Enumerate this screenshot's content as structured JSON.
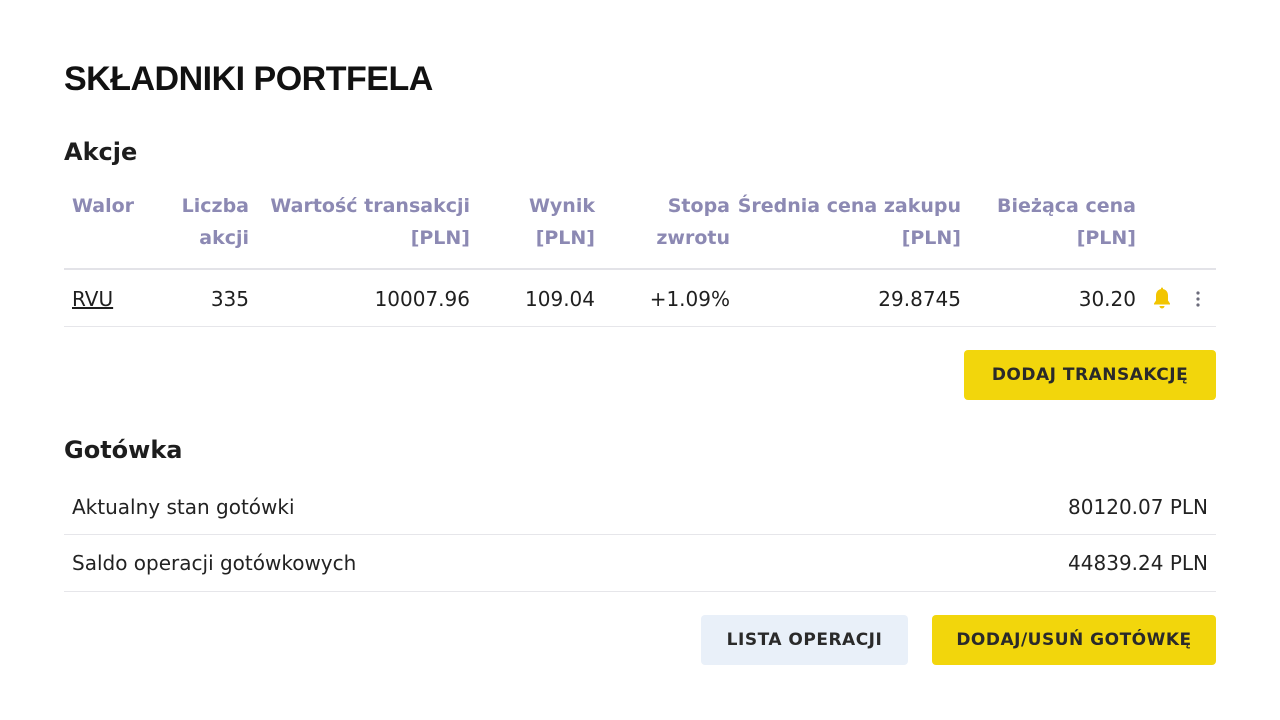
{
  "page": {
    "title": "SKŁADNIKI PORTFELA"
  },
  "stocks": {
    "title": "Akcje",
    "headers": {
      "walor": "Walor",
      "liczba_1": "Liczba",
      "liczba_2": "akcji",
      "wartosc_1": "Wartość transakcji",
      "wartosc_2": "[PLN]",
      "wynik_1": "Wynik",
      "wynik_2": "[PLN]",
      "stopa_1": "Stopa",
      "stopa_2": "zwrotu",
      "srednia_1": "Średnia cena zakupu",
      "srednia_2": "[PLN]",
      "biezaca_1": "Bieżąca cena",
      "biezaca_2": "[PLN]"
    },
    "rows": [
      {
        "walor": "RVU",
        "liczba": "335",
        "wartosc": "10007.96",
        "wynik": "109.04",
        "stopa": "+1.09%",
        "srednia": "29.8745",
        "biezaca": "30.20"
      }
    ],
    "add_transaction_label": "DODAJ TRANSAKCJĘ"
  },
  "cash": {
    "title": "Gotówka",
    "rows": [
      {
        "label": "Aktualny stan gotówki",
        "value": "80120.07 PLN"
      },
      {
        "label": "Saldo operacji gotówkowych",
        "value": "44839.24 PLN"
      }
    ],
    "operations_label": "LISTA OPERACJI",
    "add_remove_label": "DODAJ/USUŃ GOTÓWKĘ"
  },
  "icons": {
    "alert": "bell-icon",
    "menu": "kebab-menu-icon"
  },
  "colors": {
    "accent_yellow": "#f2d60c",
    "header_text": "#8c89b3",
    "positive": "#2fc28c",
    "secondary_button": "#e9f0f9"
  }
}
